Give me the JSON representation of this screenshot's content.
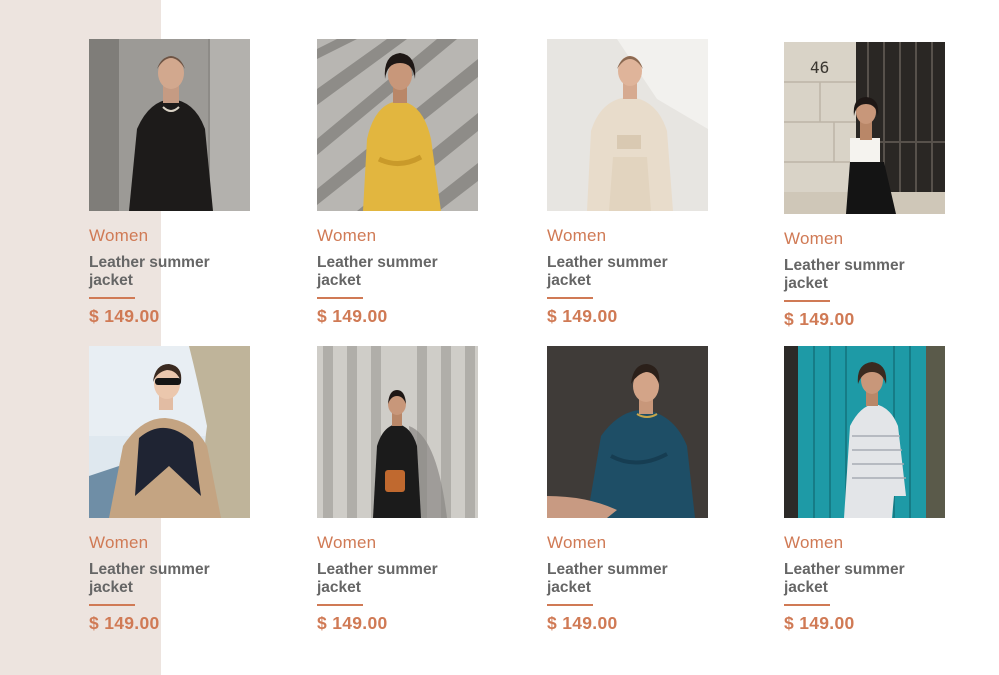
{
  "products": [
    {
      "category": "Women",
      "name": "Leather summer jacket",
      "price": "$ 149.00"
    },
    {
      "category": "Women",
      "name": "Leather summer jacket",
      "price": "$ 149.00"
    },
    {
      "category": "Women",
      "name": "Leather summer jacket",
      "price": "$ 149.00"
    },
    {
      "category": "Women",
      "name": "Leather summer jacket",
      "price": "$ 149.00",
      "photo_text": "46"
    },
    {
      "category": "Women",
      "name": "Leather summer jacket",
      "price": "$ 149.00"
    },
    {
      "category": "Women",
      "name": "Leather summer jacket",
      "price": "$ 149.00"
    },
    {
      "category": "Women",
      "name": "Leather summer jacket",
      "price": "$ 149.00"
    },
    {
      "category": "Women",
      "name": "Leather summer jacket",
      "price": "$ 149.00"
    }
  ],
  "colors": {
    "accent": "#d07a55",
    "title_text": "#666666",
    "side_panel": "#ede4df"
  }
}
